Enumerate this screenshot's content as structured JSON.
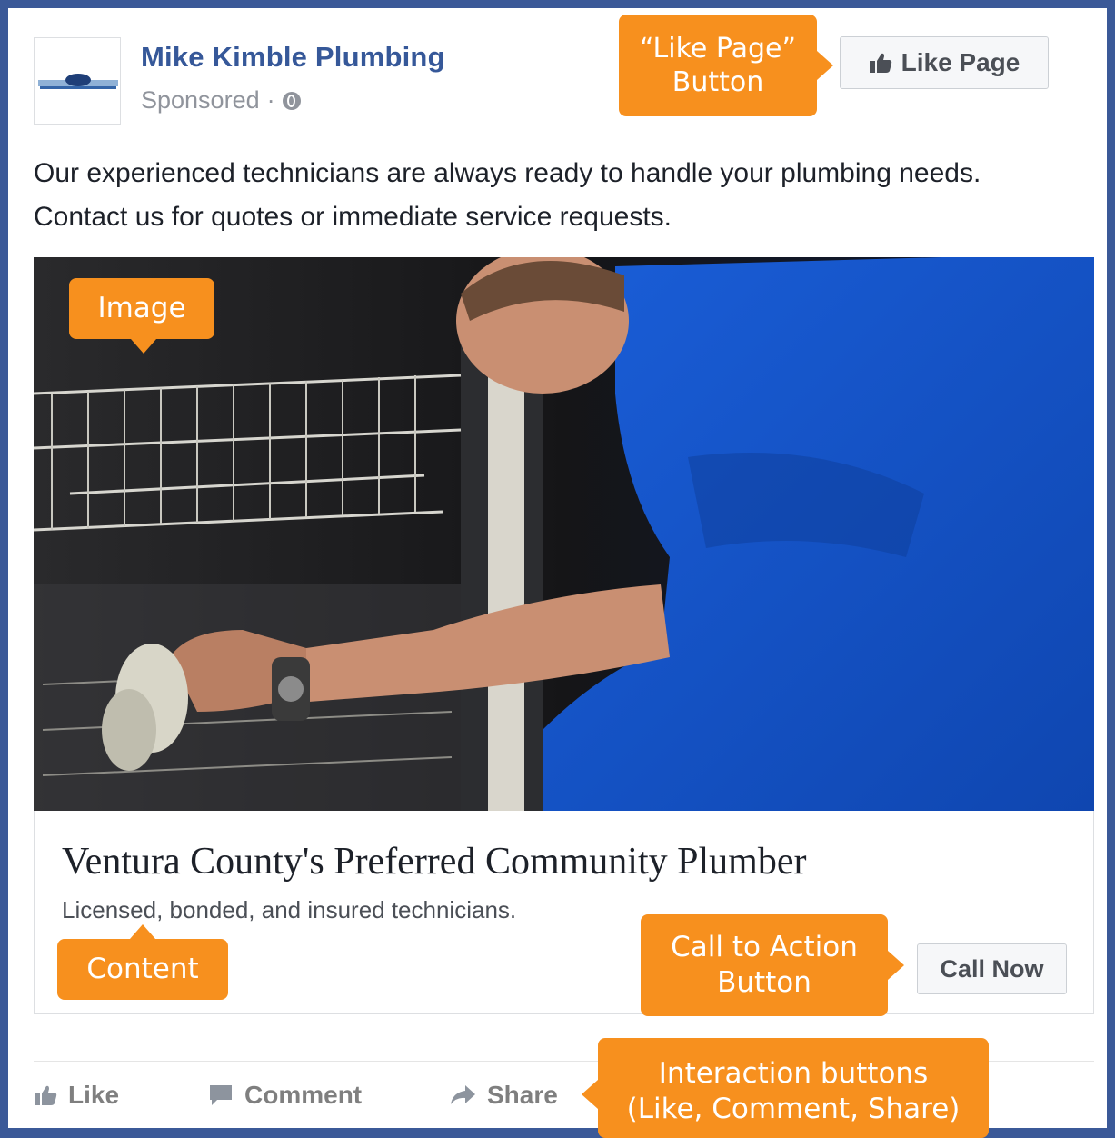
{
  "post": {
    "page_name": "Mike Kimble Plumbing",
    "sponsored_label": "Sponsored",
    "separator": "·",
    "like_page_label": "Like Page",
    "body_text": "Our experienced technicians are always ready to handle your plumbing needs. Contact us for quotes or immediate service requests.",
    "headline": "Ventura County's Preferred Community Plumber",
    "link_description": "Licensed, bonded, and insured technicians.",
    "cta_label": "Call Now"
  },
  "actions": {
    "like": "Like",
    "comment": "Comment",
    "share": "Share"
  },
  "annotations": {
    "like_page_line1": "“Like Page”",
    "like_page_line2": "Button",
    "image": "Image",
    "content": "Content",
    "cta_line1": "Call to Action",
    "cta_line2": "Button",
    "interaction_line1": "Interaction buttons",
    "interaction_line2": "(Like, Comment, Share)"
  },
  "colors": {
    "frame": "#3b5998",
    "link_blue": "#365899",
    "callout": "#f7901e",
    "shirt_blue": "#1655c8"
  }
}
